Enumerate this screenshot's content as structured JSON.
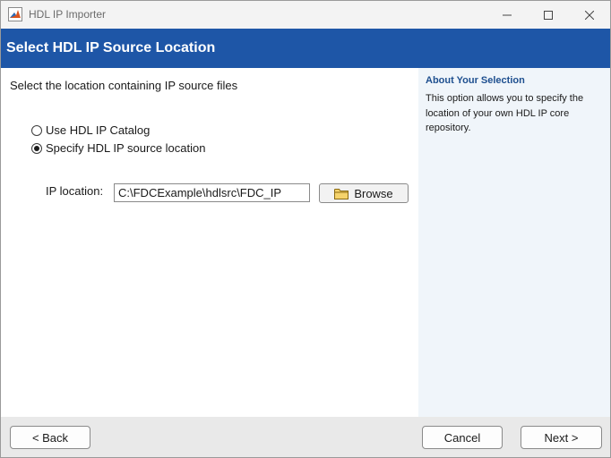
{
  "window": {
    "title": "HDL IP Importer",
    "controls": {
      "minimize": "minimize-icon",
      "maximize": "maximize-icon",
      "close": "close-icon"
    }
  },
  "banner": {
    "title": "Select HDL IP Source Location",
    "color": "#1e56a7"
  },
  "main": {
    "instruction": "Select the location containing IP source files",
    "options": [
      {
        "label": "Use HDL IP Catalog",
        "selected": false
      },
      {
        "label": "Specify HDL IP source location",
        "selected": true
      }
    ],
    "ip_location": {
      "label": "IP location:",
      "value": "C:\\FDCExample\\hdlsrc\\FDC_IP",
      "browse_label": "Browse",
      "browse_icon": "folder-icon"
    }
  },
  "side_panel": {
    "title": "About Your Selection",
    "text": "This option allows you to specify the location of your own HDL IP core repository."
  },
  "footer": {
    "back_label": "< Back",
    "cancel_label": "Cancel",
    "next_label": "Next >"
  }
}
